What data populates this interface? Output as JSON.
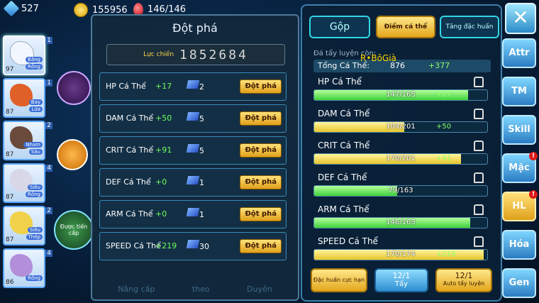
{
  "topbar": {
    "gems": "527",
    "coins": "155956",
    "stamina": "146/146"
  },
  "team": [
    {
      "lv": "97",
      "tags": [
        "Băng",
        "Rồng"
      ],
      "num": "1"
    },
    {
      "lv": "87",
      "tags": [
        "Bay",
        "Lửa"
      ],
      "num": "1"
    },
    {
      "lv": "87",
      "tags": [
        "Nham",
        "Sâu"
      ],
      "num": "2"
    },
    {
      "lv": "87",
      "tags": [
        "Siêu",
        "Rồng"
      ],
      "num": "4"
    },
    {
      "lv": "87",
      "tags": [
        "Siêu",
        "Thép"
      ],
      "num": "2"
    },
    {
      "lv": "86",
      "tags": [
        "Rồng"
      ],
      "num": "4"
    }
  ],
  "main": {
    "title": "Đột phá",
    "power_label": "Lực chiến",
    "power_value": "1852684",
    "button_label": "Đột phá",
    "rows": [
      {
        "name": "HP Cá Thể",
        "delta": "+17",
        "cost": "2"
      },
      {
        "name": "DAM Cá Thể",
        "delta": "+50",
        "cost": "5"
      },
      {
        "name": "CRIT Cá Thể",
        "delta": "+91",
        "cost": "5"
      },
      {
        "name": "DEF Cá Thể",
        "delta": "+0",
        "cost": "1"
      },
      {
        "name": "ARM Cá Thể",
        "delta": "+0",
        "cost": "1"
      },
      {
        "name": "SPEED Cá Thể",
        "delta": "+219",
        "cost": "30"
      }
    ],
    "bottom_tabs": [
      "Nâng cấp",
      "theo",
      "Duyên"
    ],
    "side_label": "Được tiến cấp"
  },
  "right": {
    "tabs": [
      "Gộp",
      "Điểm cá thể",
      "Tăng đặc huấn"
    ],
    "info": "Đá tẩy luyện còn:",
    "total_label": "Tổng Cá Thể:",
    "total_value": "876",
    "total_delta": "+377",
    "overlay_name": "R•BôGià",
    "stats": [
      {
        "name": "HP Cá Thể",
        "value": "147/165",
        "delta": "+17",
        "fill": 0.89,
        "color": "green"
      },
      {
        "name": "DAM Cá Thể",
        "value": "104/201",
        "delta": "+50",
        "fill": 0.52,
        "color": "yellow"
      },
      {
        "name": "CRIT Cá Thể",
        "value": "170/201",
        "delta": "+91",
        "fill": 0.85,
        "color": "yellow"
      },
      {
        "name": "DEF Cá Thể",
        "value": "79/163",
        "delta": "",
        "fill": 0.48,
        "color": "green"
      },
      {
        "name": "ARM Cá Thể",
        "value": "146/163",
        "delta": "",
        "fill": 0.9,
        "color": "green"
      },
      {
        "name": "SPEED Cá Thể",
        "value": "170/174",
        "delta": "+219",
        "fill": 0.98,
        "color": "yellow"
      }
    ],
    "buttons": [
      {
        "label": "Đặc huấn cực hạn"
      },
      {
        "count": "12/1",
        "label": "Tẩy"
      },
      {
        "count": "12/1",
        "label": "Auto tẩy luyện"
      }
    ]
  },
  "side_menu": [
    {
      "label": "Attr",
      "badge": ""
    },
    {
      "label": "TM",
      "badge": ""
    },
    {
      "label": "Skill",
      "badge": ""
    },
    {
      "label": "Mặc",
      "badge": "!"
    },
    {
      "label": "HL",
      "badge": "!"
    },
    {
      "label": "Hóa",
      "badge": ""
    },
    {
      "label": "Gen",
      "badge": ""
    }
  ]
}
